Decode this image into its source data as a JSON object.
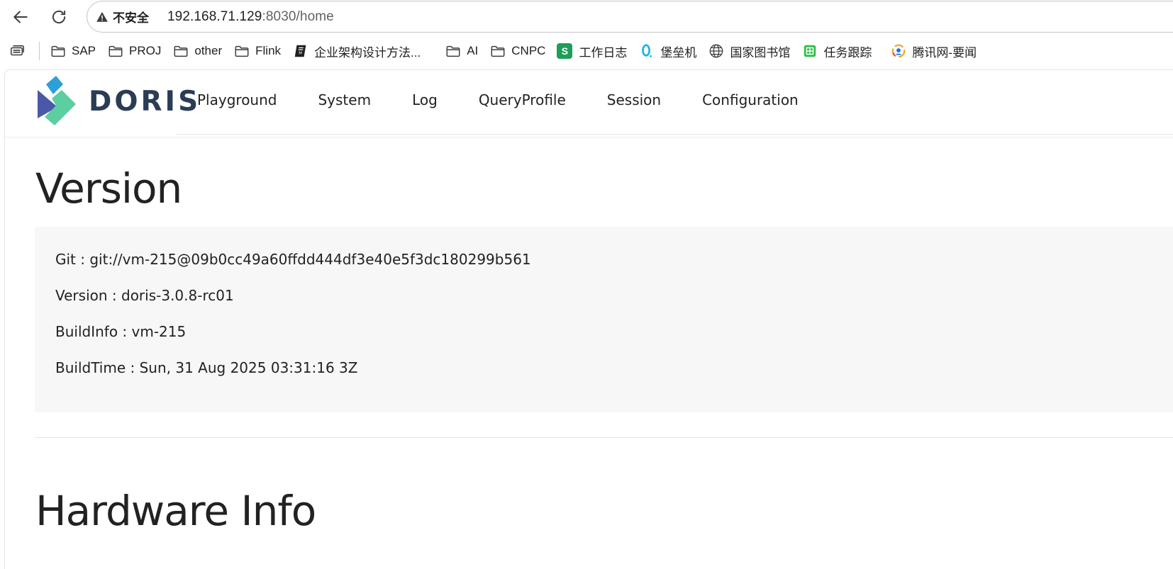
{
  "browser": {
    "security_label": "不安全",
    "url_host": "192.168.71.129",
    "url_path": ":8030/home"
  },
  "bookmarks": [
    {
      "label": "SAP",
      "icon": "folder-icon"
    },
    {
      "label": "PROJ",
      "icon": "folder-icon"
    },
    {
      "label": "other",
      "icon": "folder-icon"
    },
    {
      "label": "Flink",
      "icon": "folder-icon"
    },
    {
      "label": "企业架构设计方法...",
      "icon": "notebook-icon"
    },
    {
      "label": "AI",
      "icon": "folder-icon"
    },
    {
      "label": "CNPC",
      "icon": "folder-icon"
    },
    {
      "label": "工作日志",
      "icon": "sheet-s-icon",
      "badge_text": "S",
      "color": "#1e9e5a"
    },
    {
      "label": "堡垒机",
      "icon": "bastion-icon"
    },
    {
      "label": "国家图书馆",
      "icon": "globe-icon"
    },
    {
      "label": "任务跟踪",
      "icon": "grid-table-icon",
      "color": "#2fbf4a"
    },
    {
      "label": "腾讯网-要闻",
      "icon": "tencent-news-icon"
    }
  ],
  "app": {
    "logo_text": "DORIS",
    "nav": [
      "Playground",
      "System",
      "Log",
      "QueryProfile",
      "Session",
      "Configuration"
    ]
  },
  "version": {
    "title": "Version",
    "lines": [
      "Git : git://vm-215@09b0cc49a60ffdd444df3e40e5f3dc180299b561",
      "Version : doris-3.0.8-rc01",
      "BuildInfo : vm-215",
      "BuildTime : Sun, 31 Aug 2025 03:31:16 3Z"
    ]
  },
  "hardware": {
    "title": "Hardware Info"
  }
}
